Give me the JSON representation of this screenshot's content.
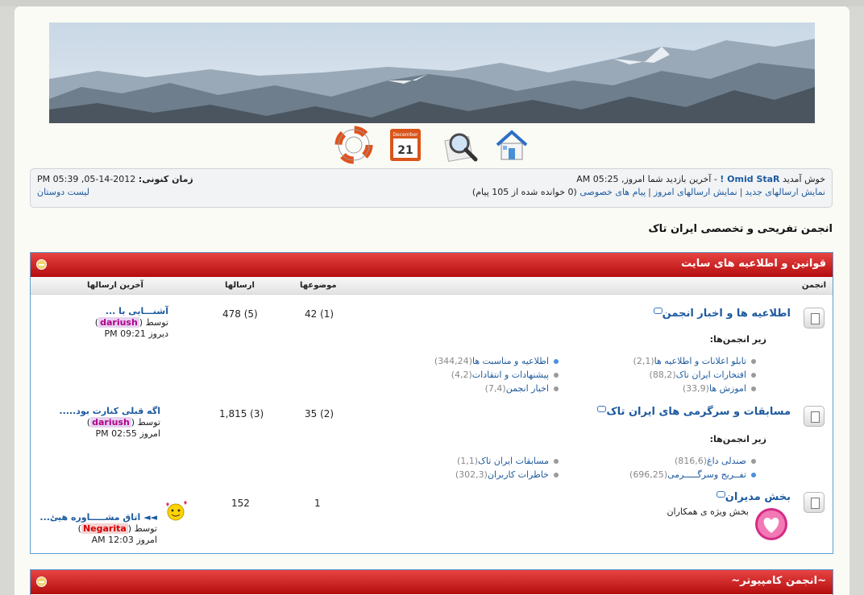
{
  "header": {
    "nav_icons": [
      "home-icon",
      "search-icon",
      "calendar-icon",
      "help-icon"
    ],
    "calendar": {
      "month": "December",
      "day": "21"
    }
  },
  "welcome": {
    "greeting": "خوش آمدید",
    "username": "Omid StaR !",
    "last_visit": "- آخرین بازدید شما امروز, 05:25 AM",
    "current_time_label": "زمان کنونی:",
    "current_time": "2012-14-05, 05:39 PM",
    "links": [
      "نمایش ارسالهای جدید",
      "نمایش ارسالهای امروز",
      "پیام های خصوصی"
    ],
    "pm_status": "(0 خوانده شده از 105 پیام)",
    "friends_link": "لیست دوستان"
  },
  "forum_title": "انجمن تفریحی و تخصصی ایران تاک",
  "columns": {
    "forum": "انجمن",
    "topics": "موضوعها",
    "posts": "ارسالها",
    "last_post": "آخرین ارسالها"
  },
  "categories": [
    {
      "title": "قوانین و اطلاعیه های سایت",
      "forums": [
        {
          "name": "اطلاعیه ها و اخبار انجمن",
          "subforums_label": "زیر انجمن‌ها:",
          "subforums": [
            {
              "name": "تابلو اعلانات و اطلاعیه ها",
              "count": "(2,1)"
            },
            {
              "name": "اطلاعیه و مناسبت ها",
              "count": "(344,24)"
            },
            {
              "name": "افتخارات ایران تاک",
              "count": "(88,2)"
            },
            {
              "name": "پیشنهادات و انتقادات",
              "count": "(4,2)"
            },
            {
              "name": "اموزش ها",
              "count": "(33,9)"
            },
            {
              "name": "اخبار انجمن",
              "count": "(7,4)"
            }
          ],
          "topics": "42 (1)",
          "posts": "478 (5)",
          "last_post": {
            "title": "آشنـــایی با ...",
            "by": "توسط",
            "user": "dariush",
            "time": "دیروز 09:21 PM"
          }
        },
        {
          "name": "مسابقات و سرگرمی های ایران تاک",
          "subforums_label": "زیر انجمن‌ها:",
          "subforums": [
            {
              "name": "صندلی داغ",
              "count": "(816,6)"
            },
            {
              "name": "مسابقات ایران تاک",
              "count": "(1,1)"
            },
            {
              "name": "تفــریح وسرگـــــرمی",
              "count": "(696,25)"
            },
            {
              "name": "خاطرات کاربران",
              "count": "(302,3)"
            }
          ],
          "topics": "35 (2)",
          "posts": "1,815 (3)",
          "last_post": {
            "title": "اگه قبلی کنارت بود.....",
            "by": "توسط",
            "user": "dariush",
            "time": "امروز 02:55 PM"
          }
        },
        {
          "name": "بخش مدیران",
          "description": "بخش ویژه ی همکاران",
          "topics": "1",
          "posts": "152",
          "last_post": {
            "title": "◄◄ اتاق مشـــــاوره هیئ...",
            "by": "توسط",
            "user": "Negarita",
            "time": "امروز 12:03 AM"
          }
        }
      ]
    },
    {
      "title": "~انجمن کامپیوتر~"
    }
  ]
}
